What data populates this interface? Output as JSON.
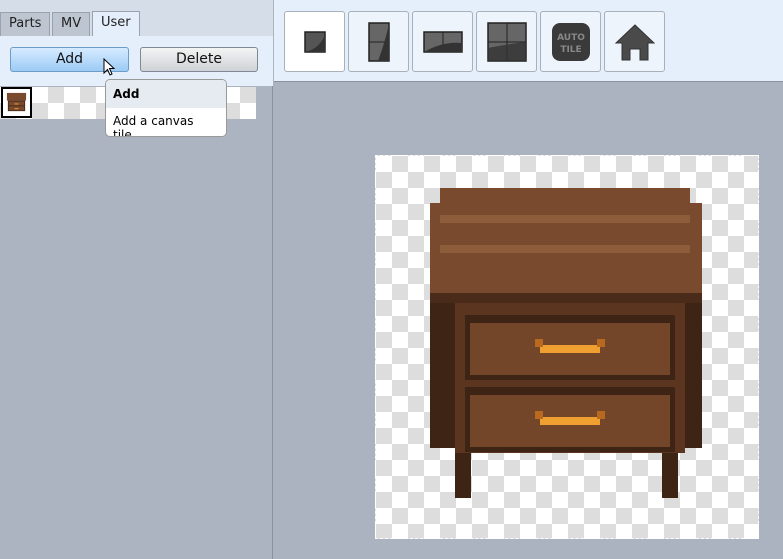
{
  "tabs": [
    {
      "label": "Parts"
    },
    {
      "label": "MV"
    },
    {
      "label": "User",
      "active": true
    }
  ],
  "buttons": {
    "add": "Add",
    "delete": "Delete"
  },
  "tooltip": {
    "title": "Add",
    "description": "Add a canvas tile."
  },
  "toolbar": [
    {
      "icon": "single-tile-icon",
      "selected": true
    },
    {
      "icon": "vertical-tile-icon"
    },
    {
      "icon": "horizontal-tile-icon"
    },
    {
      "icon": "quad-tile-icon"
    },
    {
      "icon": "autotile-icon",
      "label": "AUTO TILE"
    },
    {
      "icon": "home-icon"
    }
  ],
  "colors": {
    "wood_dark": "#3e2415",
    "wood_mid": "#6b4128",
    "wood_light": "#8a5a3a",
    "handle": "#f0a030"
  }
}
